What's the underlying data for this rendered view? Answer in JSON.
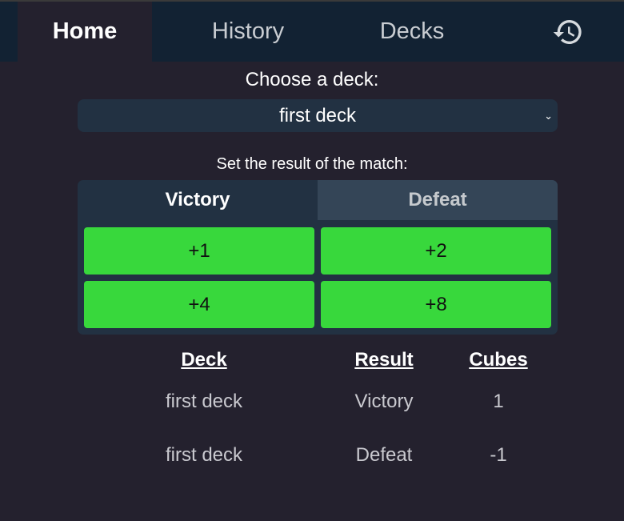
{
  "nav": {
    "tabs": [
      {
        "label": "Home"
      },
      {
        "label": "History"
      },
      {
        "label": "Decks"
      }
    ],
    "history_icon": "history-icon"
  },
  "deck_select": {
    "label": "Choose a deck:",
    "value": "first deck"
  },
  "result": {
    "label": "Set the result of the match:",
    "tabs": [
      "Victory",
      "Defeat"
    ],
    "buttons": [
      "+1",
      "+2",
      "+4",
      "+8"
    ]
  },
  "table": {
    "headers": [
      "Deck",
      "Result",
      "Cubes"
    ],
    "rows": [
      [
        "first deck",
        "Victory",
        "1"
      ],
      [
        "first deck",
        "Defeat",
        "-1"
      ]
    ]
  },
  "colors": {
    "accent": "#38d83c",
    "nav": "#122233",
    "bg": "#24212e"
  }
}
